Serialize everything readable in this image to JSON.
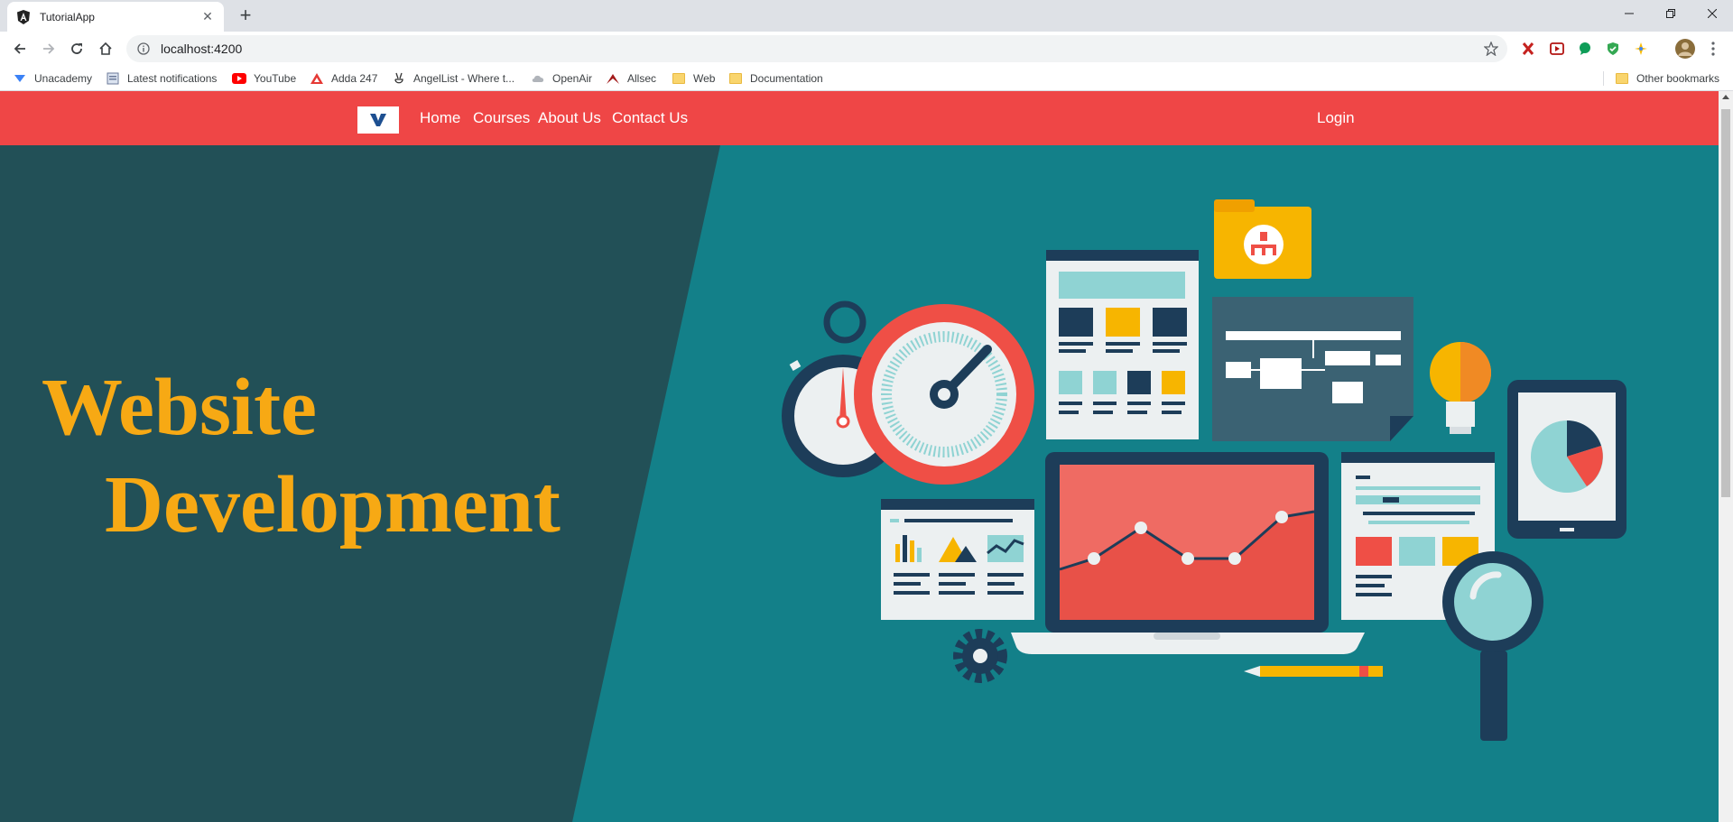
{
  "browser": {
    "tab_title": "TutorialApp",
    "new_tab_symbol": "+",
    "url": "localhost:4200",
    "window_controls": [
      "minimize",
      "restore",
      "close"
    ]
  },
  "bookmarks": [
    {
      "label": "Unacademy",
      "icon": "unacademy-icon"
    },
    {
      "label": "Latest notifications",
      "icon": "notifications-icon"
    },
    {
      "label": "YouTube",
      "icon": "youtube-icon"
    },
    {
      "label": "Adda 247",
      "icon": "adda-icon"
    },
    {
      "label": "AngelList - Where t...",
      "icon": "angellist-icon"
    },
    {
      "label": "OpenAir",
      "icon": "openair-icon"
    },
    {
      "label": "Allsec",
      "icon": "allsec-icon"
    },
    {
      "label": "Web",
      "icon": "folder-icon"
    },
    {
      "label": "Documentation",
      "icon": "folder-icon"
    }
  ],
  "other_bookmarks": "Other bookmarks",
  "site": {
    "brand_letter": "V",
    "nav": [
      "Home",
      "Courses",
      "About Us",
      "Contact Us"
    ],
    "login": "Login",
    "hero_line1": "Website",
    "hero_line2": "Development"
  },
  "colors": {
    "navbar": "#ef4646",
    "hero_dark": "#225057",
    "hero_teal": "#138089",
    "hero_text": "#f7a914"
  }
}
